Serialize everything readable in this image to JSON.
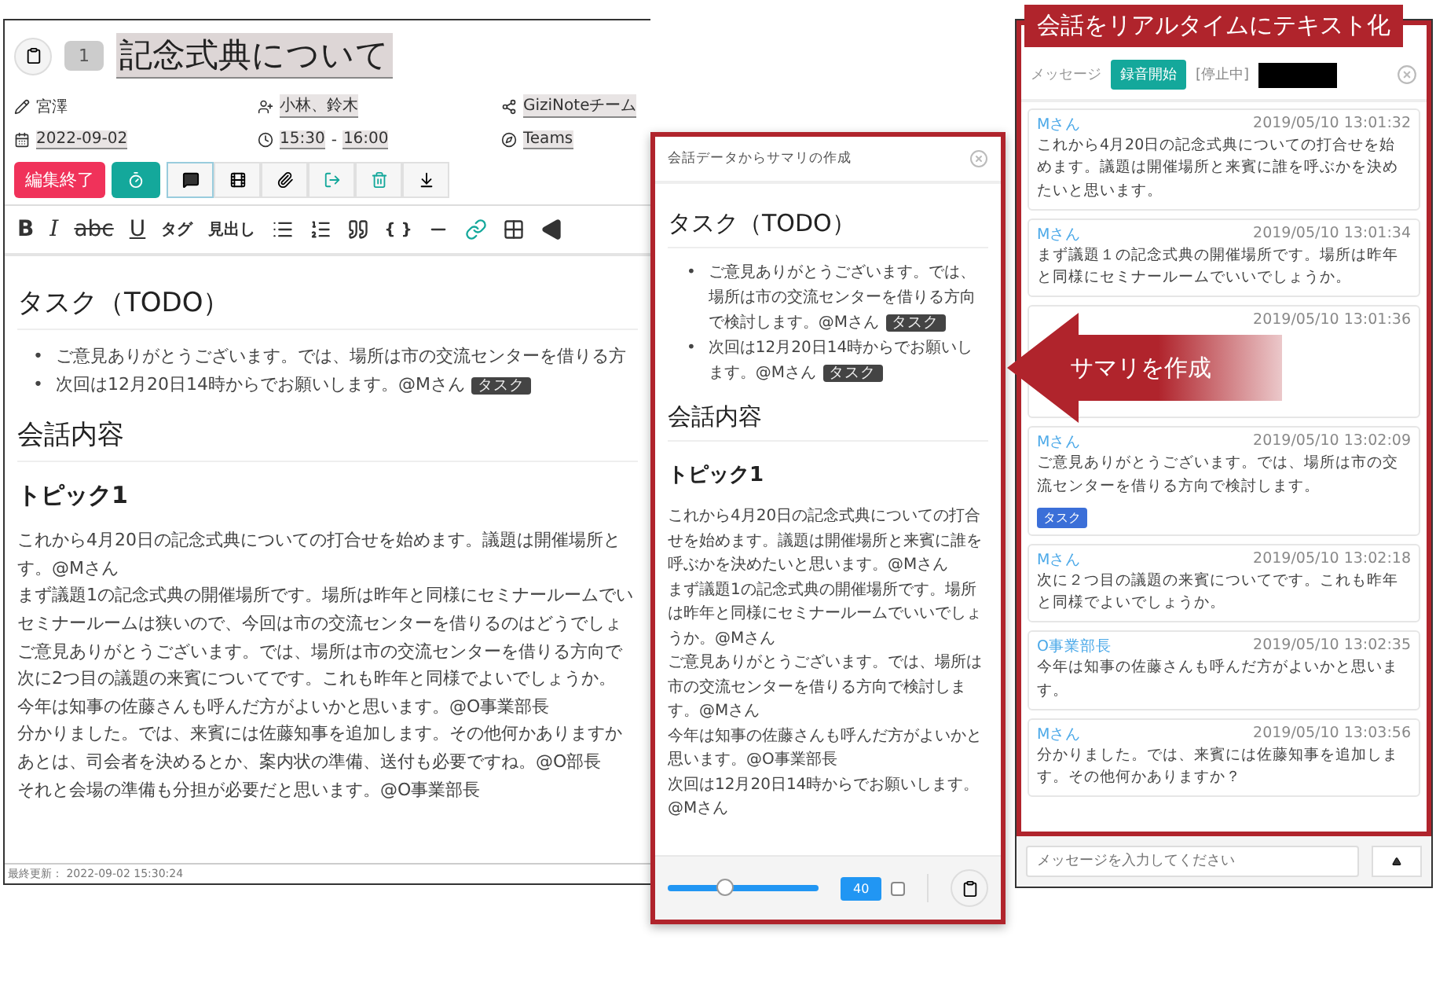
{
  "editor": {
    "title_badge": "1",
    "title": "記念式典について",
    "meta": [
      {
        "kind": "author",
        "text": "宮澤",
        "linked": false
      },
      {
        "kind": "attendees",
        "text": "小林、鈴木",
        "linked": true
      },
      {
        "kind": "team",
        "text": "GiziNoteチーム",
        "linked": true
      },
      {
        "kind": "date",
        "text": "2022-09-02",
        "linked": true
      },
      {
        "kind": "time",
        "start": "15:30",
        "separator": "-",
        "end": "16:00",
        "linked": true
      },
      {
        "kind": "tool",
        "text": "Teams",
        "linked": true
      }
    ],
    "end_edit_button": "編集終了",
    "format_toolbar": [
      {
        "kind": "bold",
        "label": "B"
      },
      {
        "kind": "italic",
        "label": "I"
      },
      {
        "kind": "strike",
        "label": "abc"
      },
      {
        "kind": "underline",
        "label": "U"
      },
      {
        "kind": "text",
        "label": "タグ"
      },
      {
        "kind": "text",
        "label": "見出し"
      },
      {
        "kind": "icon"
      },
      {
        "kind": "icon"
      },
      {
        "kind": "icon"
      },
      {
        "kind": "text",
        "label": "{ }"
      },
      {
        "kind": "icon"
      },
      {
        "kind": "icon"
      },
      {
        "kind": "icon"
      },
      {
        "kind": "icon"
      }
    ],
    "tasks_heading": "タスク（TODO）",
    "tasks": [
      {
        "bullet": "•",
        "text": "ご意見ありがとうございます。では、場所は市の交流センターを借りる方"
      },
      {
        "bullet": "•",
        "text": "次回は12月20日14時からでお願いします。@Mさん",
        "tag": "タスク"
      }
    ],
    "conversation_heading": "会話内容",
    "topic_heading": "トピック1",
    "lines": [
      "これから4月20日の記念式典についての打合せを始めます。議題は開催場所と",
      "す。@Mさん",
      "まず議題1の記念式典の開催場所です。場所は昨年と同様にセミナールームでい",
      "セミナールームは狭いので、今回は市の交流センターを借りるのはどうでしょ",
      "ご意見ありがとうございます。では、場所は市の交流センターを借りる方向で",
      "次に2つ目の議題の来賓についてです。これも昨年と同様でよいでしょうか。",
      "今年は知事の佐藤さんも呼んだ方がよいかと思います。@O事業部長",
      "分かりました。では、来賓には佐藤知事を追加します。その他何かありますか",
      "あとは、司会者を決めるとか、案内状の準備、送付も必要ですね。@O部長",
      "それと会場の準備も分担が必要だと思います。@O事業部長"
    ],
    "status": "最終更新： 2022-09-02 15:30:24"
  },
  "summary": {
    "title": "会話データからサマリの作成",
    "tasks_heading": "タスク（TODO）",
    "tasks": [
      {
        "bullet": "•",
        "text": "ご意見ありがとうございます。では、場所は市の交流センターを借りる方向で検討します。@Mさん",
        "tag": "タスク"
      },
      {
        "bullet": "•",
        "text": "次回は12月20日14時からでお願いします。@Mさん",
        "tag": "タスク"
      }
    ],
    "conversation_heading": "会話内容",
    "topic_heading": "トピック1",
    "lines": [
      "これから4月20日の記念式典についての打合せを始めます。議題は開催場所と来賓に誰を呼ぶかを決めたいと思います。@Mさん",
      "まず議題1の記念式典の開催場所です。場所は昨年と同様にセミナールームでいいでしょうか。@Mさん",
      "ご意見ありがとうございます。では、場所は市の交流センターを借りる方向で検討します。@Mさん",
      "今年は知事の佐藤さんも呼んだ方がよいかと思います。@O事業部長",
      "次回は12月20日14時からでお願いします。@Mさん"
    ],
    "slider": {
      "level": 0.38
    },
    "value": "40",
    "checked": false
  },
  "chat": {
    "label": "メッセージ",
    "record_button": "録音開始",
    "record_status": "[停止中]",
    "messages": [
      {
        "sender": "Mさん",
        "time": "2019/05/10 13:01:32",
        "text": "これから4月20日の記念式典についての打合せを始めます。議題は開催場所と来賓に誰を呼ぶかを決めたいと思います。"
      },
      {
        "sender": "Mさん",
        "time": "2019/05/10 13:01:34",
        "text": "まず議題１の記念式典の開催場所です。場所は昨年と同様にセミナールームでいいでしょうか。"
      },
      {
        "time": "2019/05/10 13:01:36"
      },
      {
        "sender": "Mさん",
        "time": "2019/05/10 13:02:09",
        "text": "ご意見ありがとうございます。では、場所は市の交流センターを借りる方向で検討します。",
        "tag": "タスク"
      },
      {
        "sender": "Mさん",
        "time": "2019/05/10 13:02:18",
        "text": "次に２つ目の議題の来賓についてです。これも昨年と同様でよいでしょうか。"
      },
      {
        "sender": "O事業部長",
        "time": "2019/05/10 13:02:35",
        "text": "今年は知事の佐藤さんも呼んだ方がよいかと思います。"
      },
      {
        "sender": "Mさん",
        "time": "2019/05/10 13:03:56",
        "text": "分かりました。では、来賓には佐藤知事を追加します。その他何かありますか？"
      }
    ],
    "input": {
      "placeholder": "メッセージを入力してください"
    }
  },
  "callouts": [
    {
      "kind": "banner",
      "text": "会話をリアルタイムにテキスト化"
    },
    {
      "kind": "arrow",
      "text": "サマリを作成"
    }
  ]
}
